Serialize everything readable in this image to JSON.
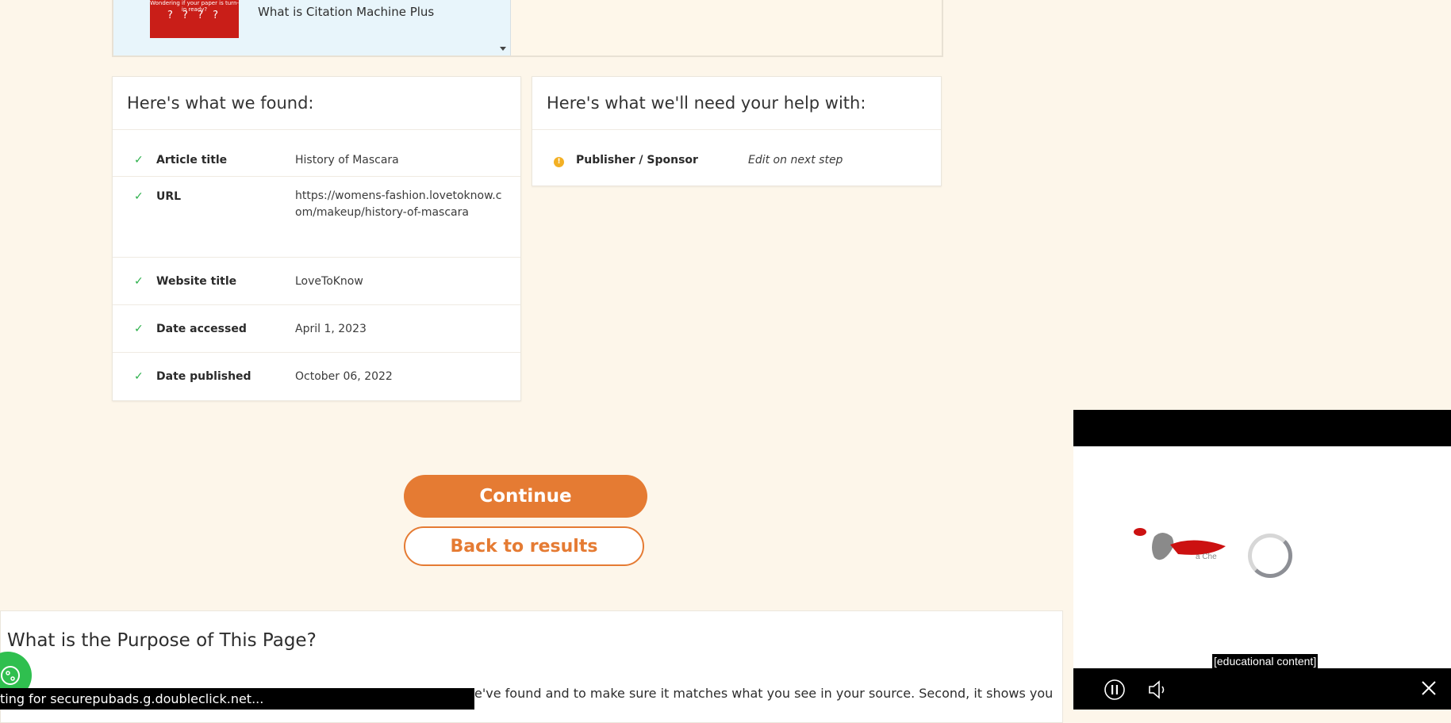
{
  "promo": {
    "thumb_caption": "Wondering if your paper is turn-in ready?",
    "thumb_marks": "? ? ? ?",
    "title": "What is Citation Machine Plus"
  },
  "found": {
    "heading": "Here's what we found:",
    "rows": [
      {
        "label": "Article title",
        "value": "History of Mascara"
      },
      {
        "label": "URL",
        "value": "https://womens-fashion.lovetoknow.com/makeup/history-of-mascara"
      },
      {
        "label": "Website title",
        "value": "LoveToKnow"
      },
      {
        "label": "Date accessed",
        "value": "April 1, 2023"
      },
      {
        "label": "Date published",
        "value": "October 06, 2022"
      }
    ]
  },
  "help": {
    "heading": "Here's what we'll need your help with:",
    "rows": [
      {
        "label": "Publisher / Sponsor",
        "value": "Edit on next step"
      }
    ]
  },
  "buttons": {
    "continue": "Continue",
    "back": "Back to results"
  },
  "purpose": {
    "title": "What is the Purpose of This Page?",
    "text": "e've found and to make sure it matches what you see in your source. Second, it shows you"
  },
  "status_bar": "ting for securepubads.g.doubleclick.net...",
  "video": {
    "caption": "[educational content]",
    "logo_text": "a Che"
  },
  "colors": {
    "background": "#fdf6ea",
    "accent": "#e57b33",
    "check": "#2bb04a",
    "warning": "#f3b024"
  }
}
